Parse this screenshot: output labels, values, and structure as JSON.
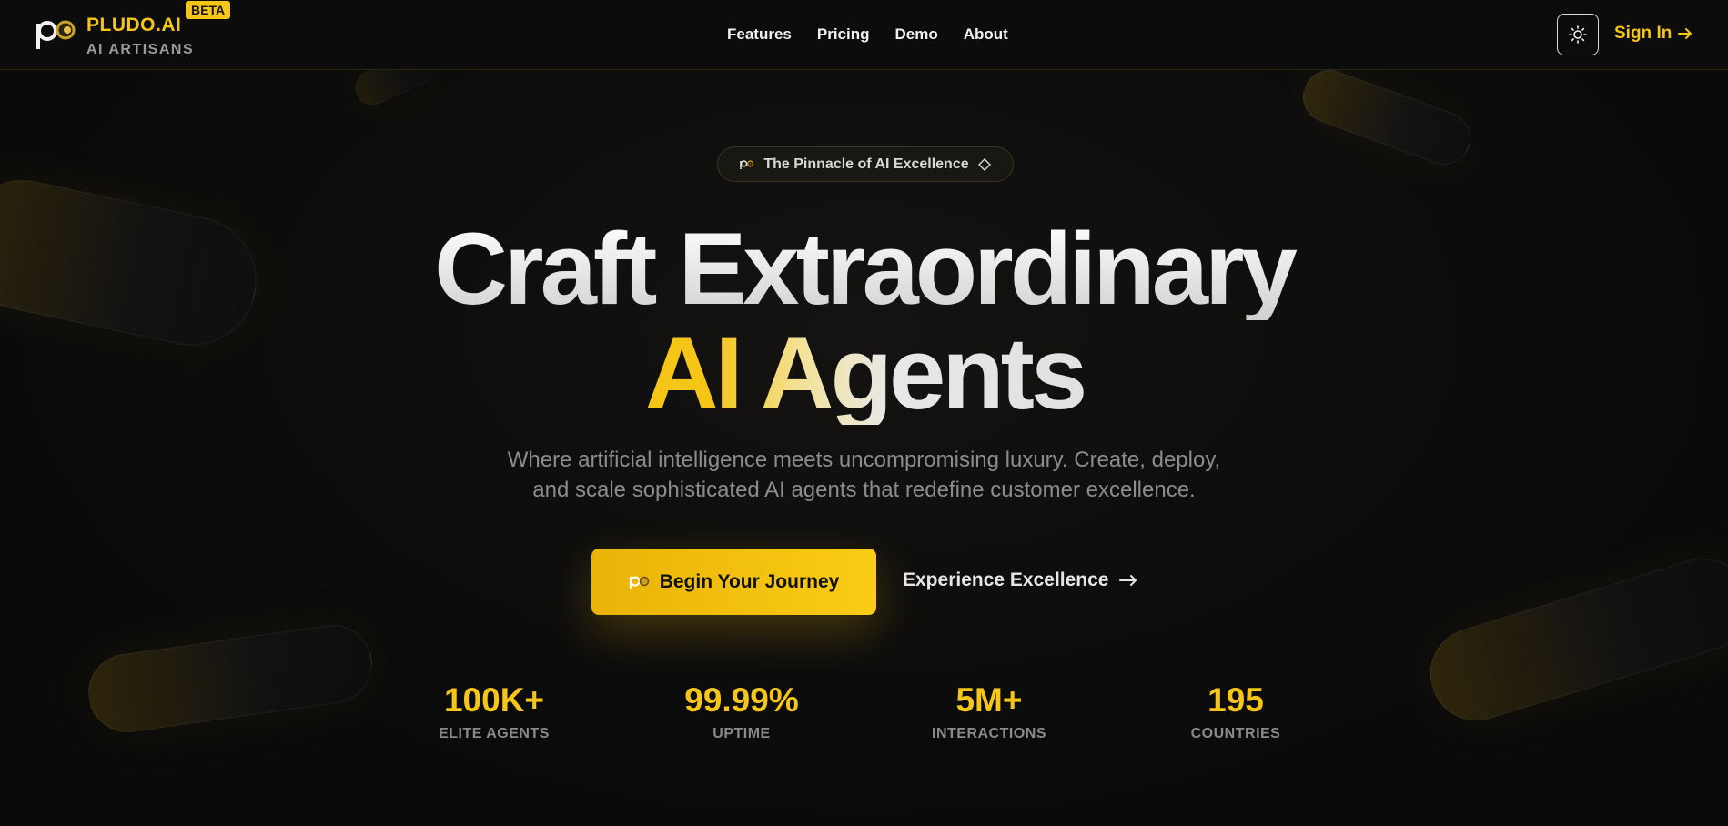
{
  "header": {
    "brand_name": "PLUDO.AI",
    "beta_label": "BETA",
    "brand_sub": "AI ARTISANS",
    "logo_icon": "pludo-logo-icon",
    "nav": [
      "Features",
      "Pricing",
      "Demo",
      "About"
    ],
    "theme_toggle_icon": "sun-icon",
    "signin_label": "Sign In",
    "signin_icon": "arrow-right-icon"
  },
  "hero": {
    "pill_text": "The Pinnacle of AI Excellence",
    "pill_icon": "diamond-icon",
    "headline_line1": "Craft Extraordinary",
    "headline_line2": "AI Agents",
    "subtitle_line1": "Where artificial intelligence meets uncompromising luxury. Create, deploy,",
    "subtitle_line2": "and scale sophisticated AI agents that redefine customer excellence.",
    "cta_primary": "Begin Your Journey",
    "cta_secondary": "Experience Excellence",
    "cta_secondary_icon": "arrow-right-icon"
  },
  "stats": [
    {
      "value": "100K+",
      "label": "ELITE AGENTS"
    },
    {
      "value": "99.99%",
      "label": "UPTIME"
    },
    {
      "value": "5M+",
      "label": "INTERACTIONS"
    },
    {
      "value": "195",
      "label": "COUNTRIES"
    }
  ],
  "colors": {
    "accent": "#f5c518",
    "background": "#0b0b0b",
    "text": "#e8e8e8",
    "muted": "#8c8c8c"
  }
}
